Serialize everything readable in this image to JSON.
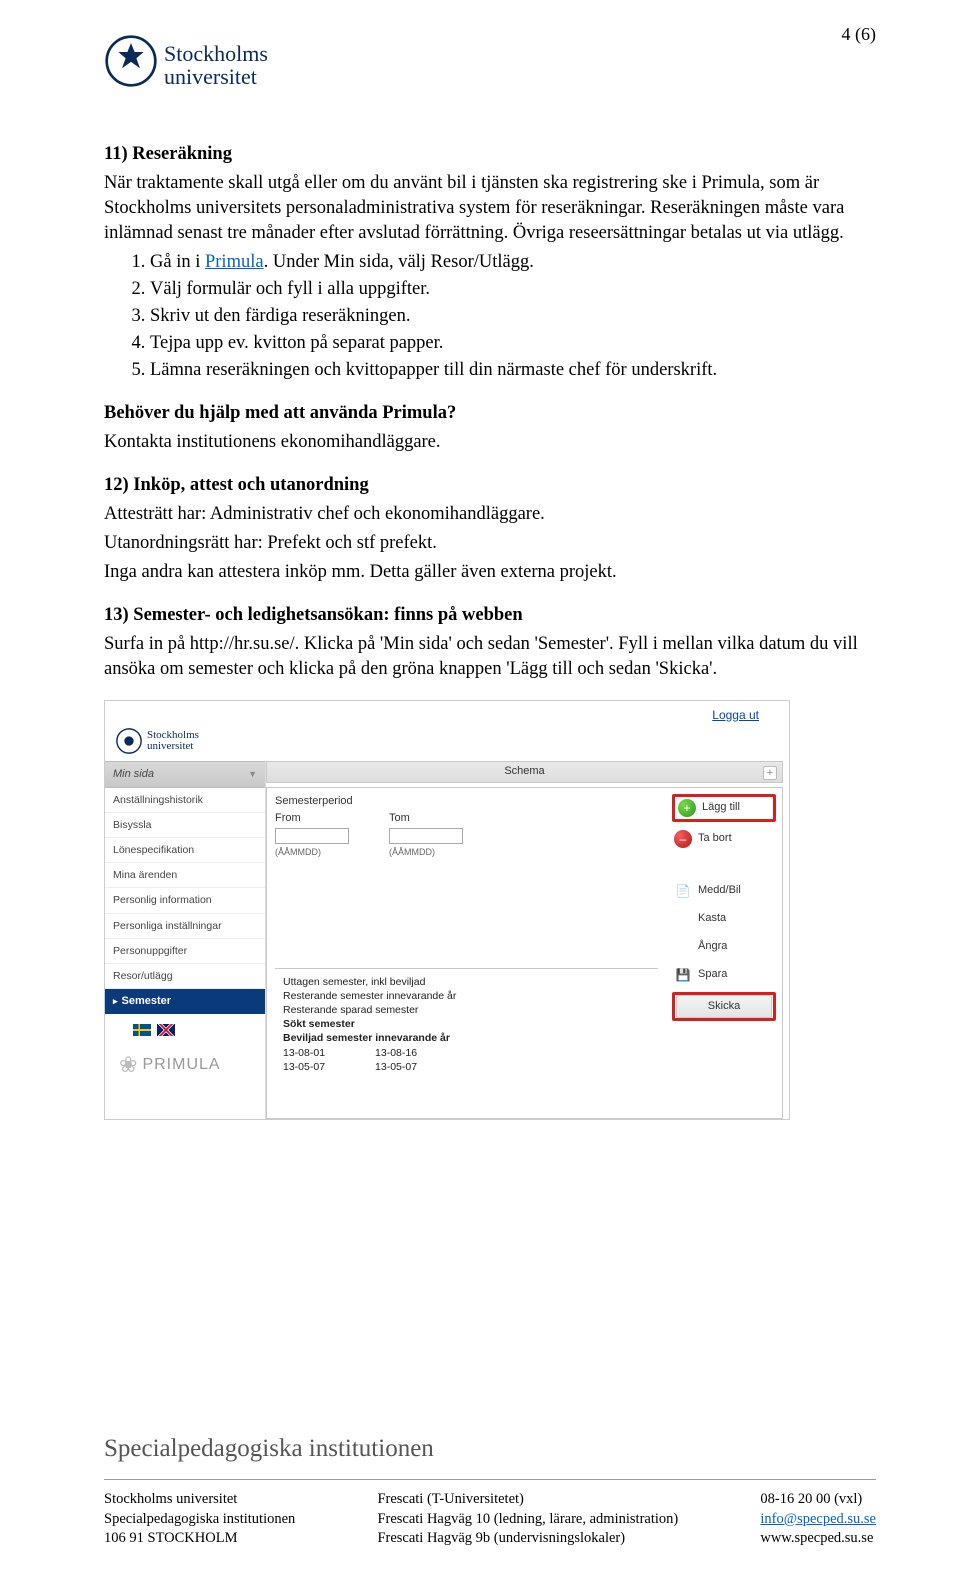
{
  "page": {
    "number": "4 (6)"
  },
  "logo": {
    "line1": "Stockholms",
    "line2": "universitet"
  },
  "sections": {
    "s11": {
      "heading": "11) Reseräkning",
      "p1": "När traktamente skall utgå eller om du använt bil i tjänsten ska registrering ske i Primula, som är Stockholms universitets personaladministrativa system för reseräkningar. Reseräkningen måste vara inlämnad senast tre månader efter avslutad förrättning. Övriga reseersättningar betalas ut via utlägg.",
      "p2": "",
      "list": {
        "0": {
          "pre": "Gå in i",
          "link": "Primula",
          "post": ". Under Min sida, välj Resor/Utlägg."
        },
        "1": "Välj formulär och fyll i alla uppgifter.",
        "2": "Skriv ut den färdiga reseräkningen.",
        "3": "Tejpa upp ev. kvitton på separat papper.",
        "4": "Lämna reseräkningen och kvittopapper till din närmaste chef för underskrift."
      }
    },
    "help": {
      "heading": "Behöver du hjälp med att använda Primula?",
      "p1": "Kontakta institutionens ekonomihandläggare."
    },
    "s12": {
      "heading": "12) Inköp, attest och utanordning",
      "p1": "Attesträtt har: Administrativ chef och ekonomihandläggare.",
      "p2": "Utanordningsrätt har: Prefekt och stf prefekt.",
      "p3": "Inga andra kan attestera inköp mm. Detta gäller även externa projekt."
    },
    "s13": {
      "heading": "13) Semester- och ledighetsansökan: finns på webben",
      "p1": "Surfa in på http://hr.su.se/. Klicka på 'Min sida' och sedan 'Semester'. Fyll i mellan vilka datum du vill ansöka om semester och klicka på den gröna knappen 'Lägg till och sedan 'Skicka'."
    }
  },
  "primula": {
    "logout": "Logga ut",
    "logo": {
      "l1": "Stockholms",
      "l2": "universitet"
    },
    "brand": "PRIMULA",
    "side": {
      "header": "Min sida",
      "items": [
        "Anställningshistorik",
        "Bisyssla",
        "Lönespecifikation",
        "Mina ärenden",
        "Personlig information",
        "Personliga inställningar",
        "Personuppgifter",
        "Resor/utlägg"
      ],
      "active": "Semester"
    },
    "main": {
      "schema": "Schema",
      "period": "Semesterperiod",
      "from": "From",
      "tom": "Tom",
      "fmt": "(ÅÅMMDD)"
    },
    "buttons": {
      "add": "Lägg till",
      "remove": "Ta bort",
      "medd": "Medd/Bil",
      "kasta": "Kasta",
      "angra": "Ångra",
      "spara": "Spara",
      "skicka": "Skicka"
    },
    "summary": {
      "l1": "Uttagen semester, inkl beviljad",
      "l2": "Resterande semester innevarande år",
      "l3": "Resterande sparad semester",
      "l4": "Sökt semester",
      "l5": "Beviljad semester innevarande år",
      "d1a": "13-08-01",
      "d1b": "13-08-16",
      "d2a": "13-05-07",
      "d2b": "13-05-07"
    }
  },
  "footer": {
    "title": "Specialpedagogiska institutionen",
    "col1": {
      "l1": "Stockholms universitet",
      "l2": "Specialpedagogiska institutionen",
      "l3": "106 91 STOCKHOLM"
    },
    "col2": {
      "l1": "Frescati (T-Universitetet)",
      "l2": "Frescati Hagväg 10 (ledning, lärare, administration)",
      "l3": "Frescati Hagväg 9b (undervisningslokaler)"
    },
    "col3": {
      "l1": "08-16 20 00 (vxl)",
      "l2": "info@specped.su.se",
      "l3": "www.specped.su.se"
    }
  }
}
